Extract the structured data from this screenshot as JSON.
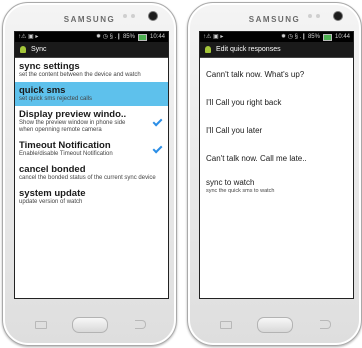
{
  "left_phone": {
    "brand": "SAMSUNG",
    "status": {
      "left": "↑⚠ ▣ ▸",
      "right": "✹ ◷ § .❙ 85%",
      "time": "10:44"
    },
    "actionbar": {
      "title": "Sync"
    },
    "items": [
      {
        "title": "sync settings",
        "subtitle": "set the content between the device and watch"
      },
      {
        "title": "quick sms",
        "subtitle": "set quick sms rejected calls"
      },
      {
        "title": "Display preview windo..",
        "subtitle": "Show the preview window in phone side when openning remote camera"
      },
      {
        "title": "Timeout Notification",
        "subtitle": "Enable/disable Timeout Notification"
      },
      {
        "title": "cancel bonded",
        "subtitle": "cancel the bonded status of the current sync device"
      },
      {
        "title": "system update",
        "subtitle": "update version of watch"
      }
    ]
  },
  "right_phone": {
    "brand": "SAMSUNG",
    "status": {
      "left": "↑⚠ ▣ ▸",
      "right": "✹ ◷ § .❙ 85%",
      "time": "10:44"
    },
    "actionbar": {
      "title": "Edit quick responses"
    },
    "responses": [
      "Cann't talk now. What's up?",
      "I'll Call you right back",
      "I'll Call you later",
      "Can't talk now. Call me late.."
    ],
    "sync": {
      "title": "sync to watch",
      "subtitle": "sync the quick sms to watch"
    }
  },
  "colors": {
    "highlight": "#5ec1ec",
    "check": "#2b8ee6",
    "actionbar": "#1a1a1a"
  }
}
